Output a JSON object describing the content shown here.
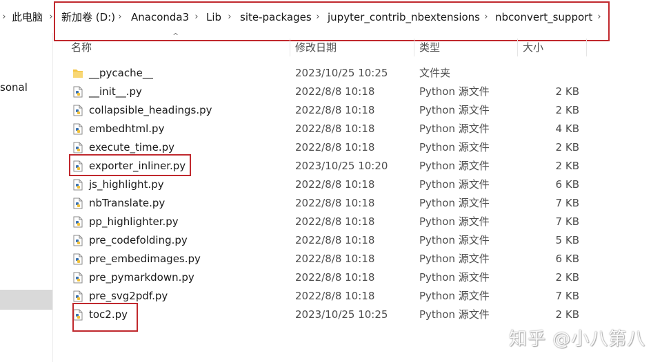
{
  "address_bar": {
    "crumbs": [
      "此电脑",
      "新加卷 (D:)",
      "Anaconda3",
      "Lib",
      "site-packages",
      "jupyter_contrib_nbextensions",
      "nbconvert_support"
    ],
    "separator_icon": "chevron-right-icon"
  },
  "nav_pane": {
    "partial_label": "sonal"
  },
  "columns": {
    "name": "名称",
    "date": "修改日期",
    "type": "类型",
    "size": "大小"
  },
  "files": [
    {
      "name": "__pycache__",
      "date": "2023/10/25 10:25",
      "type": "文件夹",
      "size": "",
      "icon": "folder-icon"
    },
    {
      "name": "__init__.py",
      "date": "2022/8/8 10:18",
      "type": "Python 源文件",
      "size": "2 KB",
      "icon": "python-file-icon"
    },
    {
      "name": "collapsible_headings.py",
      "date": "2022/8/8 10:18",
      "type": "Python 源文件",
      "size": "2 KB",
      "icon": "python-file-icon"
    },
    {
      "name": "embedhtml.py",
      "date": "2022/8/8 10:18",
      "type": "Python 源文件",
      "size": "4 KB",
      "icon": "python-file-icon"
    },
    {
      "name": "execute_time.py",
      "date": "2022/8/8 10:18",
      "type": "Python 源文件",
      "size": "2 KB",
      "icon": "python-file-icon"
    },
    {
      "name": "exporter_inliner.py",
      "date": "2023/10/25 10:20",
      "type": "Python 源文件",
      "size": "2 KB",
      "icon": "python-file-icon"
    },
    {
      "name": "js_highlight.py",
      "date": "2022/8/8 10:18",
      "type": "Python 源文件",
      "size": "6 KB",
      "icon": "python-file-icon"
    },
    {
      "name": "nbTranslate.py",
      "date": "2022/8/8 10:18",
      "type": "Python 源文件",
      "size": "7 KB",
      "icon": "python-file-icon"
    },
    {
      "name": "pp_highlighter.py",
      "date": "2022/8/8 10:18",
      "type": "Python 源文件",
      "size": "7 KB",
      "icon": "python-file-icon"
    },
    {
      "name": "pre_codefolding.py",
      "date": "2022/8/8 10:18",
      "type": "Python 源文件",
      "size": "5 KB",
      "icon": "python-file-icon"
    },
    {
      "name": "pre_embedimages.py",
      "date": "2022/8/8 10:18",
      "type": "Python 源文件",
      "size": "6 KB",
      "icon": "python-file-icon"
    },
    {
      "name": "pre_pymarkdown.py",
      "date": "2022/8/8 10:18",
      "type": "Python 源文件",
      "size": "2 KB",
      "icon": "python-file-icon"
    },
    {
      "name": "pre_svg2pdf.py",
      "date": "2022/8/8 10:18",
      "type": "Python 源文件",
      "size": "7 KB",
      "icon": "python-file-icon"
    },
    {
      "name": "toc2.py",
      "date": "2023/10/25 10:25",
      "type": "Python 源文件",
      "size": "2 KB",
      "icon": "python-file-icon"
    }
  ],
  "highlight_color": "#c0282d",
  "watermark": "知乎 @小八第八"
}
